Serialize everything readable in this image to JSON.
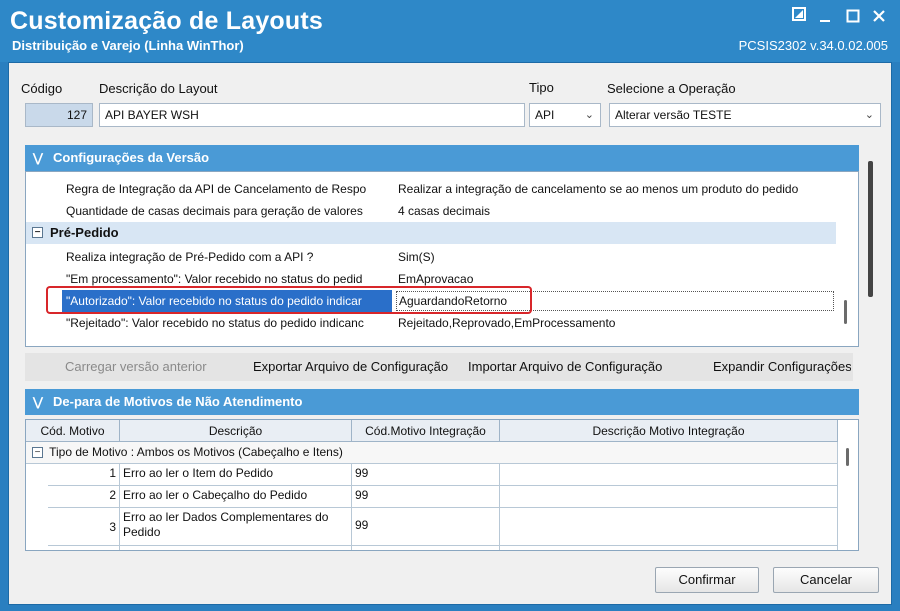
{
  "window": {
    "title": "Customização de Layouts",
    "subtitle": "Distribuição e Varejo (Linha WinThor)",
    "version": "PCSIS2302  v.34.0.02.005"
  },
  "header": {
    "codigo_label": "Código",
    "codigo_value": "127",
    "descricao_label": "Descrição do Layout",
    "descricao_value": "API BAYER WSH",
    "tipo_label": "Tipo",
    "tipo_value": "API",
    "operacao_label": "Selecione a Operação",
    "operacao_value": "Alterar versão TESTE"
  },
  "config_panel": {
    "title": "Configurações da Versão",
    "rows_top": [
      {
        "name": "Regra de Integração da API de Cancelamento de Respo",
        "value": "Realizar a integração de cancelamento se ao menos um produto do pedido"
      },
      {
        "name": "Quantidade de casas decimais para geração de valores",
        "value": "4 casas decimais"
      }
    ],
    "category": "Pré-Pedido",
    "rows": [
      {
        "name": "Realiza integração de Pré-Pedido com a API ?",
        "value": "Sim(S)"
      },
      {
        "name": "\"Em processamento\": Valor recebido no status do pedid",
        "value": "EmAprovacao"
      },
      {
        "name": "\"Autorizado\": Valor recebido no status do pedido indicar",
        "value": "AguardandoRetorno"
      },
      {
        "name": "\"Rejeitado\": Valor recebido no status do pedido indicanc",
        "value": "Rejeitado,Reprovado,EmProcessamento"
      }
    ]
  },
  "toolbar": {
    "carregar": "Carregar versão anterior",
    "exportar": "Exportar Arquivo de Configuração",
    "importar": "Importar Arquivo de Configuração",
    "expandir": "Expandir Configurações"
  },
  "depara_panel": {
    "title": "De-para de Motivos de Não Atendimento",
    "columns": [
      "Cód. Motivo",
      "Descrição",
      "Cód.Motivo Integração",
      "Descrição Motivo Integração"
    ],
    "group": "Tipo de Motivo : Ambos os Motivos (Cabeçalho e Itens)",
    "rows": [
      {
        "cod": "1",
        "desc": "Erro ao ler o Item do Pedido",
        "cod_int": "99",
        "desc_int": ""
      },
      {
        "cod": "2",
        "desc": "Erro ao ler o Cabeçalho do Pedido",
        "cod_int": "99",
        "desc_int": ""
      },
      {
        "cod": "3",
        "desc": "Erro ao ler Dados Complementares do Pedido",
        "cod_int": "99",
        "desc_int": ""
      }
    ]
  },
  "footer": {
    "confirmar": "Confirmar",
    "cancelar": "Cancelar"
  },
  "colors": {
    "title_bar": "#2e88c8",
    "panel_header": "#4a9ad6",
    "selection": "#2a6fc9",
    "highlight_border": "#d8262a"
  }
}
